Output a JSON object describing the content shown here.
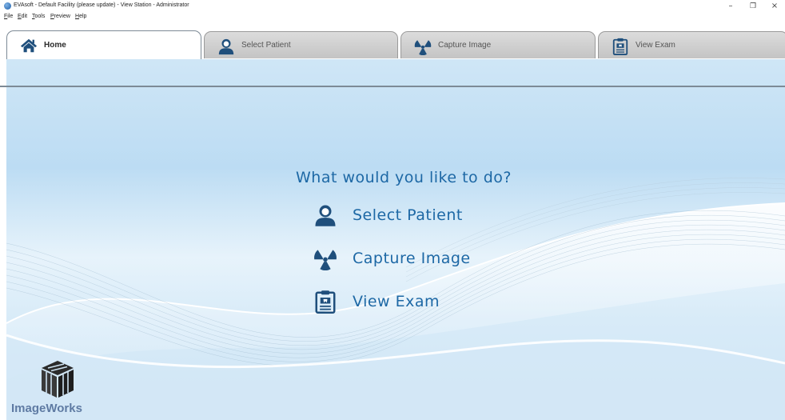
{
  "window": {
    "title": "EVAsoft - Default Facility (please update) - View Station - Administrator",
    "minimize_glyph": "–",
    "maximize_glyph": "❐",
    "close_glyph": "×"
  },
  "menu": {
    "items": [
      {
        "label": "File"
      },
      {
        "label": "Edit"
      },
      {
        "label": "Tools"
      },
      {
        "label": "Preview"
      },
      {
        "label": "Help"
      }
    ]
  },
  "tabs": [
    {
      "label": "Home",
      "icon": "home-icon",
      "active": true
    },
    {
      "label": "Select Patient",
      "icon": "patient-icon",
      "active": false
    },
    {
      "label": "Capture Image",
      "icon": "radiation-icon",
      "active": false
    },
    {
      "label": "View Exam",
      "icon": "exam-clipboard-icon",
      "active": false
    }
  ],
  "main": {
    "prompt": "What would you like to do?",
    "actions": [
      {
        "label": "Select Patient",
        "icon": "patient-icon"
      },
      {
        "label": "Capture Image",
        "icon": "radiation-icon"
      },
      {
        "label": "View Exam",
        "icon": "exam-clipboard-icon"
      }
    ]
  },
  "branding": {
    "logo_text": "ImageWorks"
  },
  "colors": {
    "accent_blue": "#1d68a5",
    "icon_dark_blue": "#1f4f7c",
    "tab_inactive": "#d0d0d0",
    "logo_text": "#5f7ba3"
  }
}
